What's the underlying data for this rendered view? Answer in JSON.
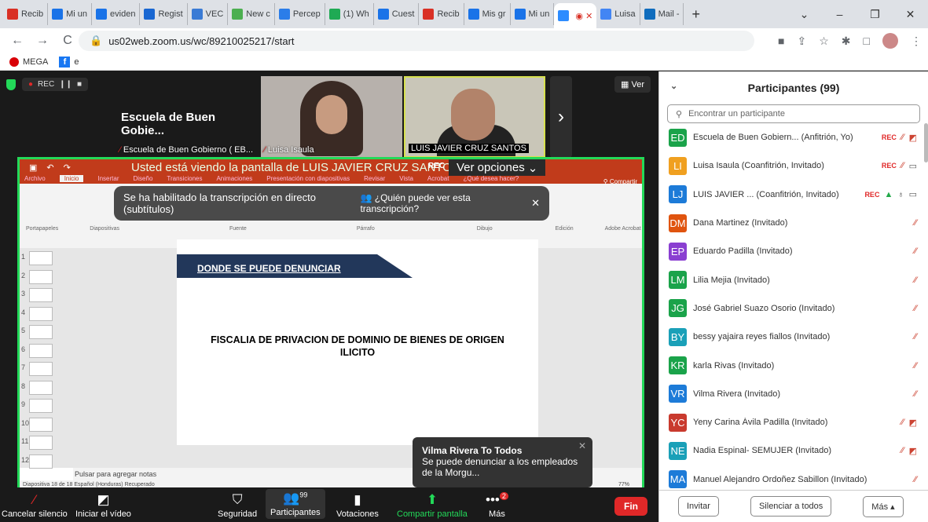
{
  "browser": {
    "tabs": [
      {
        "label": "Recib",
        "icon": "gmail-icon",
        "color": "#d93025"
      },
      {
        "label": "Mi un",
        "icon": "drive-icon",
        "color": "#1a73e8"
      },
      {
        "label": "eviden",
        "icon": "forms-icon",
        "color": "#1a73e8"
      },
      {
        "label": "Regist",
        "icon": "sheets-icon",
        "color": "#1967d2"
      },
      {
        "label": "VEC",
        "icon": "vec-icon",
        "color": "#3a7bd5"
      },
      {
        "label": "New c",
        "icon": "newc-icon",
        "color": "#4caf50"
      },
      {
        "label": "Percep",
        "icon": "percep-icon",
        "color": "#2b7de9"
      },
      {
        "label": "(1) Wh",
        "icon": "whatsapp-icon",
        "color": "#1faa54"
      },
      {
        "label": "Cuest",
        "icon": "forms-icon",
        "color": "#1a73e8"
      },
      {
        "label": "Recib",
        "icon": "gmail-icon",
        "color": "#d93025"
      },
      {
        "label": "Mis gr",
        "icon": "zoom-icon",
        "color": "#1a73e8"
      },
      {
        "label": "Mi un",
        "icon": "drive-icon",
        "color": "#1a73e8"
      },
      {
        "label": "",
        "icon": "zoom-active-icon",
        "color": "#2d8cff"
      },
      {
        "label": "Luisa",
        "icon": "google-icon",
        "color": "#4285f4"
      },
      {
        "label": "Mail -",
        "icon": "outlook-icon",
        "color": "#0f6cbd"
      }
    ],
    "new_tab": "+",
    "url": "us02web.zoom.us/wc/89210025217/start",
    "bookmarks": [
      {
        "label": "MEGA",
        "icon": "mega-icon"
      },
      {
        "label": "e",
        "icon": "facebook-icon"
      }
    ]
  },
  "meeting": {
    "rec_label": "REC",
    "ver_label": "Ver",
    "videos": [
      {
        "name": "Escuela de Buen Gobie...",
        "label": "Escuela de Buen Gobierno ( EB..."
      },
      {
        "label": "Luisa Isaula"
      },
      {
        "label": "LUIS JAVIER CRUZ SANTOS"
      }
    ],
    "share_banner": "Usted está viendo la pantalla de LUIS JAVIER CRUZ SANTOS",
    "share_rec": "REC",
    "options_label": "Ver opciones",
    "caption_toast": "Se ha habilitado la transcripción en directo (subtítulos)",
    "caption_who": "¿Quién puede ver esta transcripción?",
    "ppt_tabs": [
      "Archivo",
      "Inicio",
      "Insertar",
      "Diseño",
      "Transiciones",
      "Animaciones",
      "Presentación con diapositivas",
      "Revisar",
      "Vista",
      "Acrobat",
      "¿Qué desea hacer?"
    ],
    "ppt_share": "Compartir",
    "slide_head": "DONDE SE PUEDE DENUNCIAR",
    "slide_body": "FISCALIA DE PRIVACION DE DOMINIO DE BIENES DE ORIGEN ILICITO",
    "notes": "Pulsar para agregar notas",
    "status": "Diapositiva 18 de 18   Español (Honduras)   Recuperado",
    "zoom_pct": "77%",
    "chat_from": "Vilma Rivera To Todos",
    "chat_msg": "Se puede denunciar a los empleados de la Morgu...",
    "toolbar": {
      "unmute": "Cancelar silencio",
      "video": "Iniciar el vídeo",
      "security": "Seguridad",
      "participants": "Participantes",
      "participants_count": "99",
      "polls": "Votaciones",
      "share": "Compartir pantalla",
      "more": "Más",
      "more_badge": "2",
      "end": "Fin"
    }
  },
  "panel": {
    "title": "Participantes (99)",
    "search_placeholder": "Encontrar un participante",
    "participants": [
      {
        "initials": "ED",
        "color": "#1aa34a",
        "name": "Escuela de Buen Gobiern... (Anfitrión, Yo)",
        "rec": "REC",
        "muted": true,
        "video_off": true
      },
      {
        "initials": "LI",
        "color": "#f0a020",
        "name": "Luisa Isaula (Coanfitrión, Invitado)",
        "rec": "REC",
        "muted": true,
        "video_off": false
      },
      {
        "initials": "LJ",
        "color": "#1d7bd8",
        "name": "LUIS JAVIER ... (Coanfitrión, Invitado)",
        "rec": "REC",
        "muted": false,
        "video_off": false
      },
      {
        "initials": "DM",
        "color": "#e0540f",
        "name": "Dana Martinez (Invitado)",
        "muted": true
      },
      {
        "initials": "EP",
        "color": "#8a3fd1",
        "name": "Eduardo Padilla (Invitado)",
        "muted": true
      },
      {
        "initials": "LM",
        "color": "#1aa34a",
        "name": "Lilia Mejia (Invitado)",
        "muted": true
      },
      {
        "initials": "JG",
        "color": "#1aa34a",
        "name": "José Gabriel Suazo Osorio (Invitado)",
        "muted": true
      },
      {
        "initials": "BY",
        "color": "#1aa0b8",
        "name": "bessy yajaira reyes fiallos (Invitado)",
        "muted": true
      },
      {
        "initials": "KR",
        "color": "#1aa34a",
        "name": "karla Rivas (Invitado)",
        "muted": true
      },
      {
        "initials": "VR",
        "color": "#1d7bd8",
        "name": "Vilma Rivera (Invitado)",
        "muted": true
      },
      {
        "initials": "YC",
        "color": "#c93a2e",
        "name": "Yeny Carina Ávila Padilla (Invitado)",
        "muted": true,
        "video_off": true
      },
      {
        "initials": "NE",
        "color": "#1aa0b8",
        "name": "Nadia Espinal- SEMUJER (Invitado)",
        "muted": true,
        "video_off": true
      },
      {
        "initials": "MA",
        "color": "#1d7bd8",
        "name": "Manuel Alejandro Ordoñez Sabillon (Invitado)",
        "muted": true
      }
    ],
    "invite": "Invitar",
    "mute_all": "Silenciar a todos",
    "more": "Más"
  }
}
